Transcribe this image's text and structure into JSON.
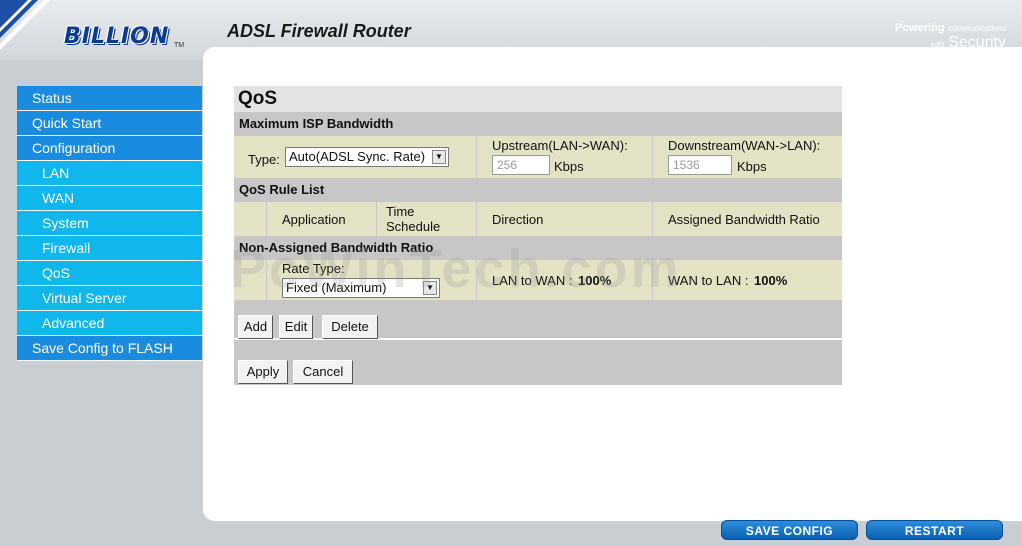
{
  "header": {
    "brand": "BILLION",
    "brand_tm": "TM",
    "title": "ADSL Firewall Router",
    "tagline_powering": "Powering",
    "tagline_communications": "communications",
    "tagline_with": "with",
    "tagline_security": "Security"
  },
  "sidebar": {
    "items": [
      {
        "label": "Status",
        "level": "main"
      },
      {
        "label": "Quick Start",
        "level": "main"
      },
      {
        "label": "Configuration",
        "level": "main"
      },
      {
        "label": "LAN",
        "level": "sub"
      },
      {
        "label": "WAN",
        "level": "sub"
      },
      {
        "label": "System",
        "level": "sub"
      },
      {
        "label": "Firewall",
        "level": "sub"
      },
      {
        "label": "QoS",
        "level": "sub"
      },
      {
        "label": "Virtual Server",
        "level": "sub"
      },
      {
        "label": "Advanced",
        "level": "sub"
      },
      {
        "label": "Save Config to FLASH",
        "level": "main"
      }
    ]
  },
  "qos": {
    "title": "QoS",
    "max_bandwidth": {
      "heading": "Maximum ISP Bandwidth",
      "type_label": "Type:",
      "type_value": "Auto(ADSL Sync. Rate)",
      "upstream_label": "Upstream(LAN->WAN):",
      "upstream_value": "256",
      "upstream_unit": "Kbps",
      "downstream_label": "Downstream(WAN->LAN):",
      "downstream_value": "1536",
      "downstream_unit": "Kbps"
    },
    "rule_list": {
      "heading": "QoS Rule List",
      "columns": [
        "Application",
        "Time Schedule",
        "Direction",
        "Assigned Bandwidth Ratio"
      ]
    },
    "non_assigned": {
      "heading": "Non-Assigned Bandwidth Ratio",
      "rate_type_label": "Rate Type:",
      "rate_type_value": "Fixed (Maximum)",
      "lan_to_wan_label": "LAN to WAN :",
      "lan_to_wan_value": "100%",
      "wan_to_lan_label": "WAN to LAN :",
      "wan_to_lan_value": "100%"
    },
    "buttons": {
      "add": "Add",
      "edit": "Edit",
      "delete": "Delete",
      "apply": "Apply",
      "cancel": "Cancel"
    }
  },
  "footer": {
    "save_config": "SAVE CONFIG",
    "restart": "RESTART"
  },
  "watermark": "PcWinTech.com",
  "colors": {
    "nav_main": "#1a8ce0",
    "nav_sub": "#0fb7ec",
    "panel_gray": "#c7c7c7",
    "panel_yellow": "#e4e2c4",
    "brand_blue": "#0b3b8f"
  }
}
